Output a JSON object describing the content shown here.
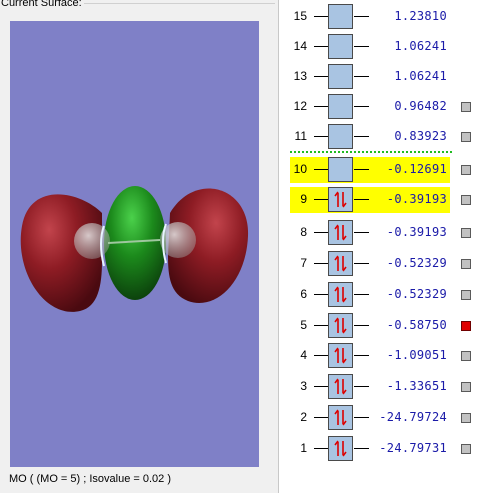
{
  "left_panel": {
    "group_label": "Current Surface:",
    "status": "MO ( (MO = 5) ; Isovalue = 0.02 )",
    "viewport_bg": "#7f80c7"
  },
  "orbitals": [
    {
      "number": "15",
      "energy": "1.23810",
      "occupancy": "empty",
      "has_checkbox": false
    },
    {
      "number": "14",
      "energy": "1.06241",
      "occupancy": "empty",
      "has_checkbox": false
    },
    {
      "number": "13",
      "energy": "1.06241",
      "occupancy": "empty",
      "has_checkbox": false
    },
    {
      "number": "12",
      "energy": "0.96482",
      "occupancy": "empty",
      "has_checkbox": true,
      "selected": false
    },
    {
      "number": "11",
      "energy": "0.83923",
      "occupancy": "empty",
      "has_checkbox": true,
      "selected": false
    },
    {
      "number": "10",
      "energy": "-0.12691",
      "occupancy": "empty",
      "has_checkbox": true,
      "selected": false,
      "highlighted": true
    },
    {
      "number": "9",
      "energy": "-0.39193",
      "occupancy": "paired",
      "has_checkbox": true,
      "selected": false,
      "highlighted": true
    },
    {
      "number": "8",
      "energy": "-0.39193",
      "occupancy": "paired",
      "has_checkbox": true,
      "selected": false
    },
    {
      "number": "7",
      "energy": "-0.52329",
      "occupancy": "paired",
      "has_checkbox": true,
      "selected": false
    },
    {
      "number": "6",
      "energy": "-0.52329",
      "occupancy": "paired",
      "has_checkbox": true,
      "selected": false
    },
    {
      "number": "5",
      "energy": "-0.58750",
      "occupancy": "paired",
      "has_checkbox": true,
      "selected": true
    },
    {
      "number": "4",
      "energy": "-1.09051",
      "occupancy": "paired",
      "has_checkbox": true,
      "selected": false
    },
    {
      "number": "3",
      "energy": "-1.33651",
      "occupancy": "paired",
      "has_checkbox": true,
      "selected": false
    },
    {
      "number": "2",
      "energy": "-24.79724",
      "occupancy": "paired",
      "has_checkbox": true,
      "selected": false
    },
    {
      "number": "1",
      "energy": "-24.79731",
      "occupancy": "paired",
      "has_checkbox": true,
      "selected": false
    }
  ],
  "colors": {
    "highlight": "#ffff00",
    "energy_text": "#1a1aa8",
    "box_fill": "#a9c4e2",
    "electron_arrow": "#dd0000",
    "selected_check": "#e00000",
    "homo_lumo_divider": "#22bb22",
    "lobe_negative": "#8b1a22",
    "lobe_positive": "#1f8a1f"
  }
}
